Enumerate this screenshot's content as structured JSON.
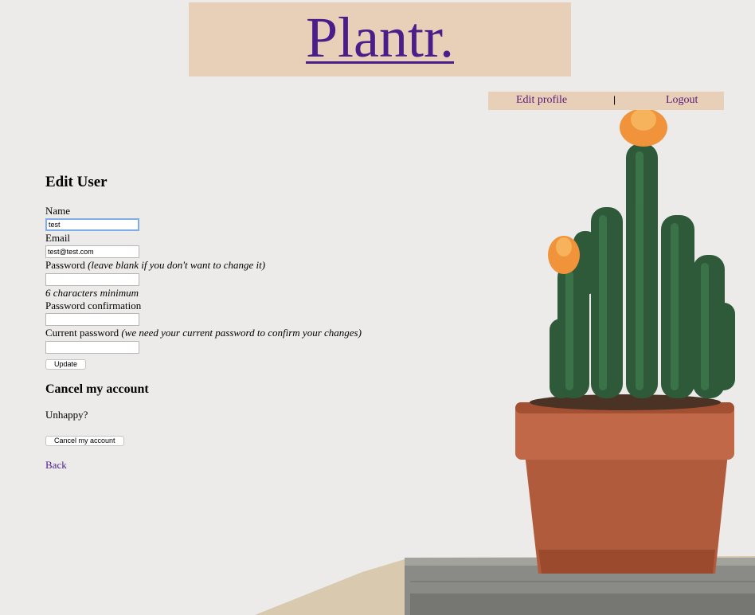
{
  "brand": {
    "title": "Plantr."
  },
  "nav": {
    "edit_profile": "Edit profile",
    "separator": "|",
    "logout": "Logout"
  },
  "edit_user": {
    "heading": "Edit User",
    "name_label": "Name",
    "name_value": "test",
    "email_label": "Email",
    "email_value": "test@test.com",
    "password_label": "Password",
    "password_note": "(leave blank if you don't want to change it)",
    "password_hint": "6 characters minimum",
    "password_confirmation_label": "Password confirmation",
    "current_password_label": "Current password",
    "current_password_note": "(we need your current password to confirm your changes)",
    "update_button": "Update"
  },
  "cancel": {
    "heading": "Cancel my account",
    "text": "Unhappy?",
    "button": "Cancel my account"
  },
  "back_link": "Back",
  "colors": {
    "background": "#ecebea",
    "banner": "#e8cfb8",
    "link": "#4b1d8a",
    "nav_link": "#5a1a7a"
  }
}
